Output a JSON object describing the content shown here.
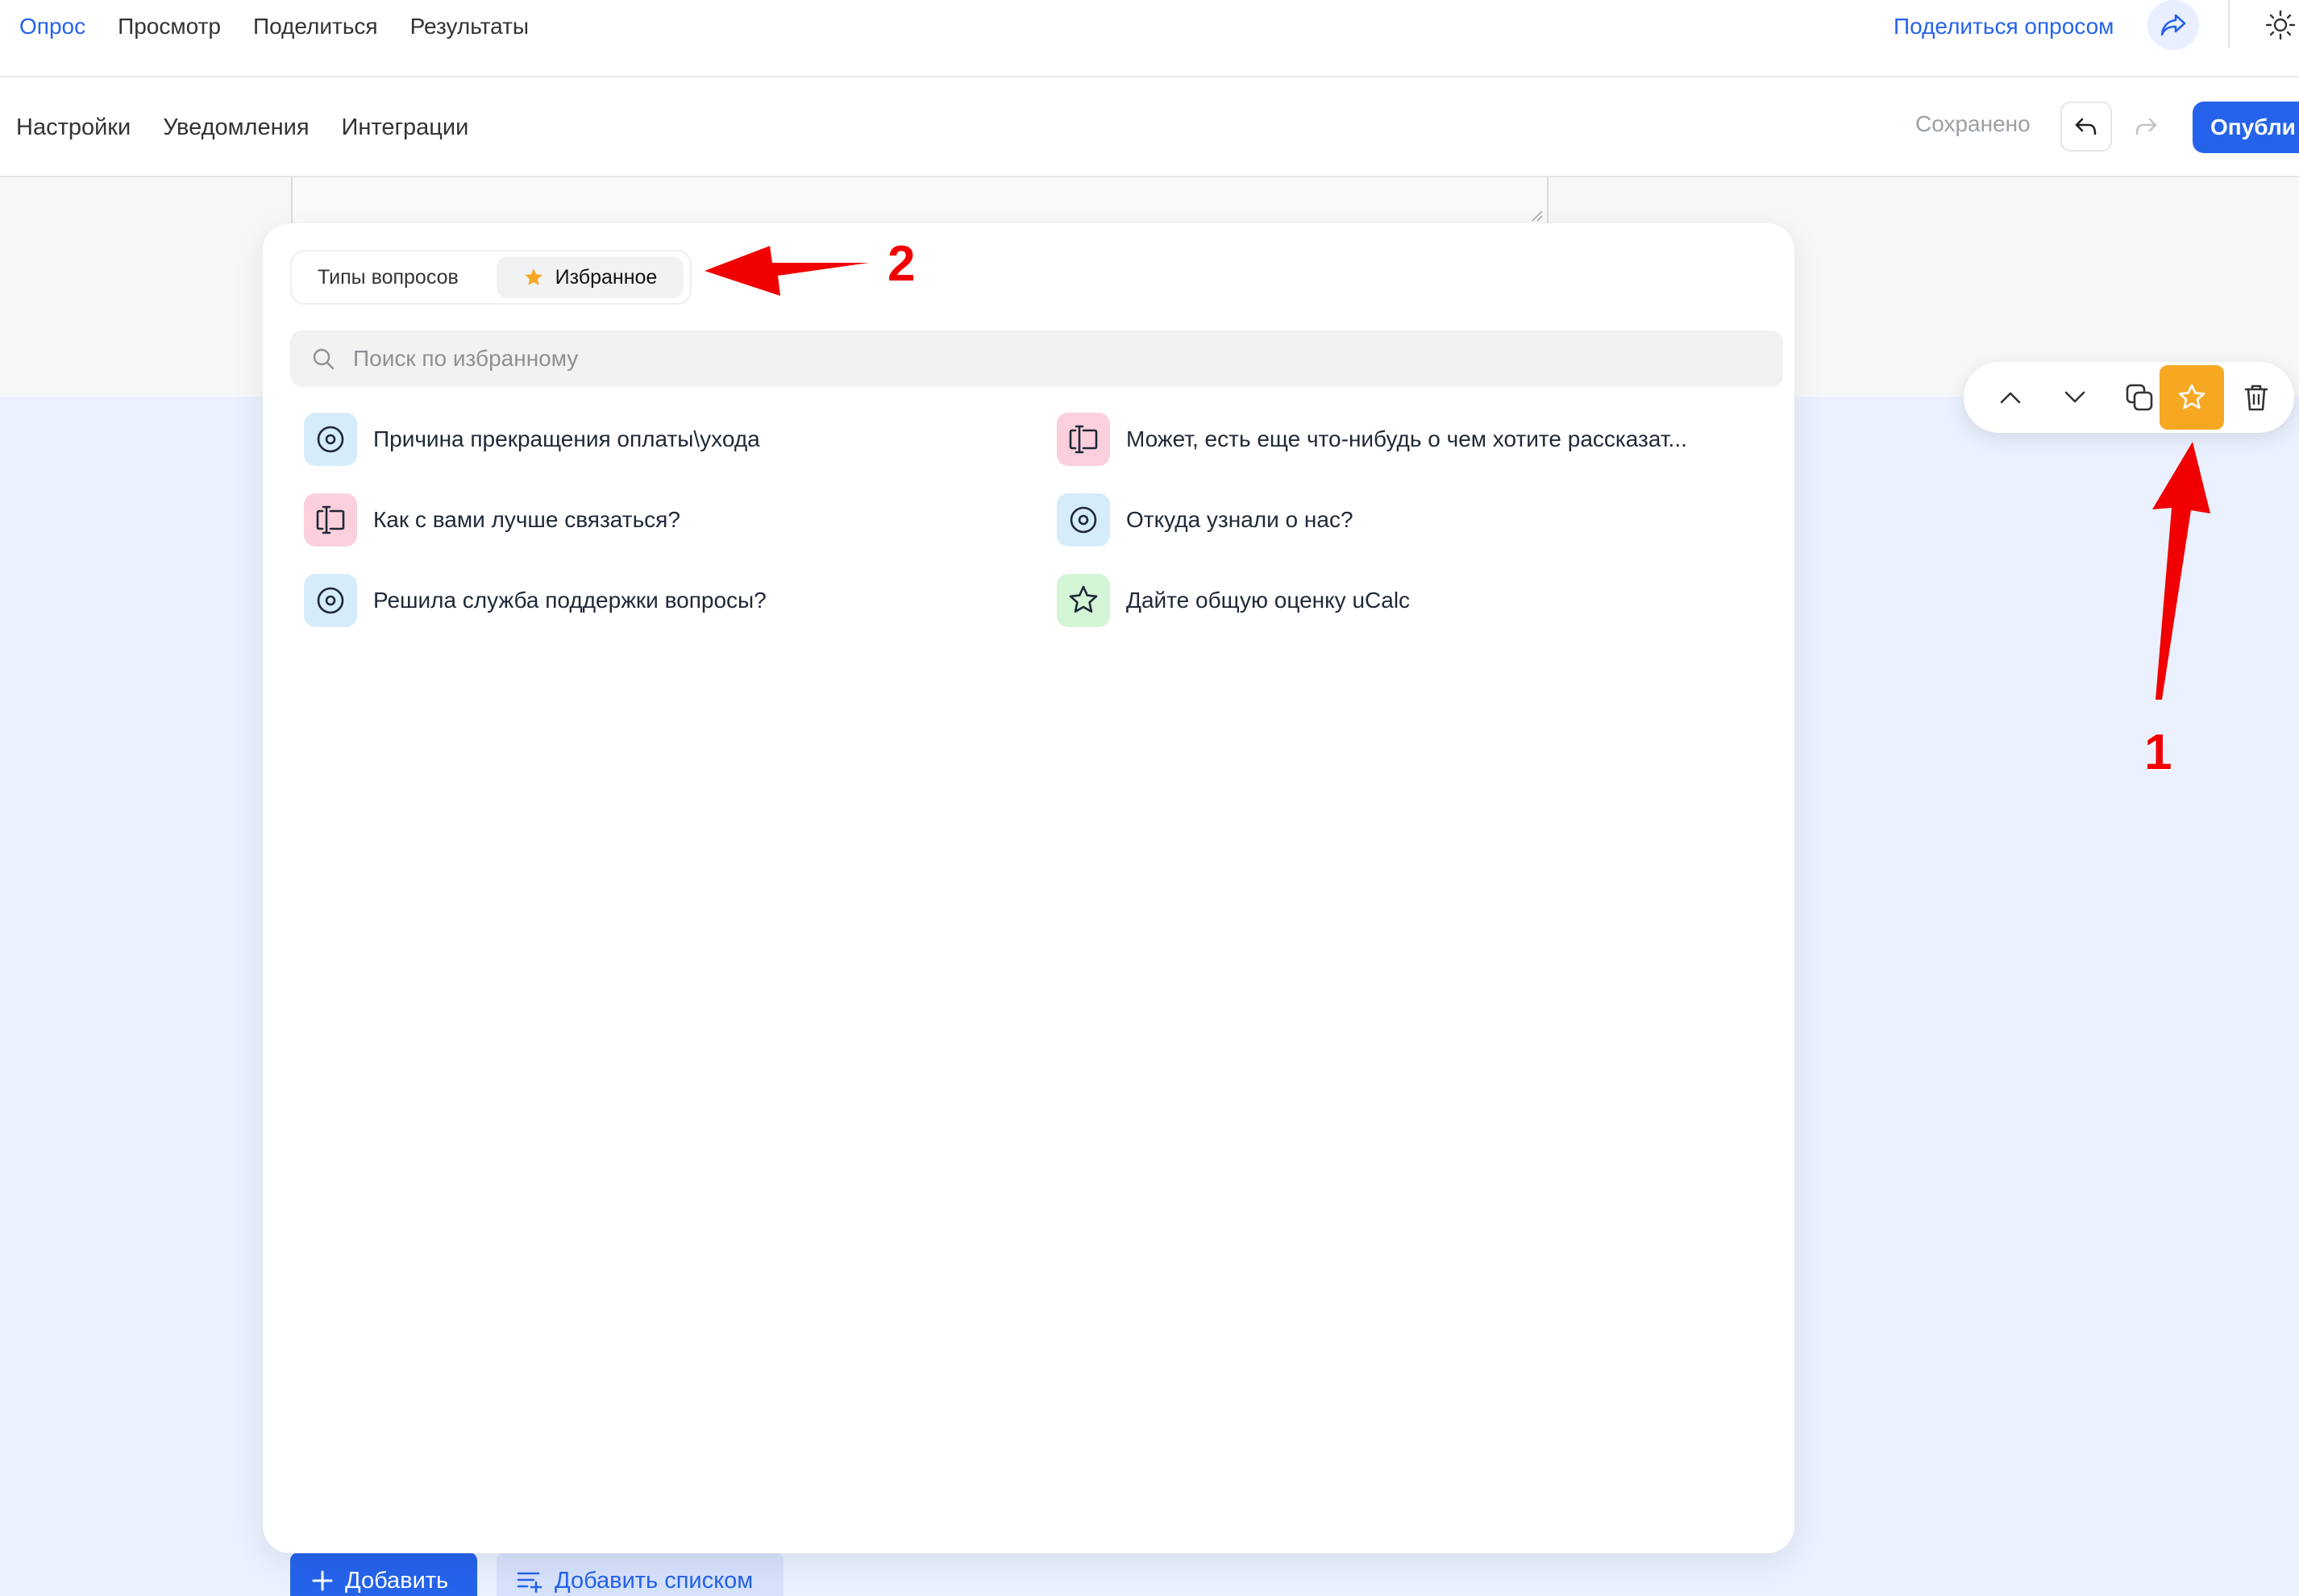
{
  "top_nav": {
    "items": [
      "Опрос",
      "Просмотр",
      "Поделиться",
      "Результаты"
    ],
    "share_link": "Поделиться опросом",
    "share_icon": "share-arrow-icon",
    "theme_icon": "sun-icon"
  },
  "sub_nav": {
    "items": [
      "Настройки",
      "Уведомления",
      "Интеграции"
    ],
    "status": "Сохранено",
    "undo_icon": "undo-icon",
    "redo_icon": "redo-icon",
    "publish": "Опубли"
  },
  "panel": {
    "tabs": {
      "types": "Типы вопросов",
      "favorites": "Избранное"
    },
    "search_placeholder": "Поиск по избранному",
    "items": [
      {
        "label": "Причина прекращения оплаты\\ухода",
        "icon": "radio-icon",
        "color": "#d5ecfb"
      },
      {
        "label": "Может, есть еще что-нибудь о чем хотите рассказат...",
        "icon": "text-field-icon",
        "color": "#fbd0dc"
      },
      {
        "label": "Как с вами лучше связаться?",
        "icon": "text-field-icon",
        "color": "#fbd0dc"
      },
      {
        "label": "Откуда узнали о нас?",
        "icon": "radio-icon",
        "color": "#d5ecfb"
      },
      {
        "label": "Решила служба поддержки вопросы?",
        "icon": "radio-icon",
        "color": "#d5ecfb"
      },
      {
        "label": "Дайте общую оценку uCalc",
        "icon": "star-icon",
        "color": "#d4f4d6"
      }
    ]
  },
  "question_toolbar": {
    "buttons": [
      "chevron-up-icon",
      "chevron-down-icon",
      "duplicate-icon",
      "star-icon",
      "trash-icon"
    ],
    "active_color": "#f7a823"
  },
  "bottom": {
    "add": "Добавить",
    "add_list": "Добавить списком"
  },
  "annotations": {
    "label_1": "1",
    "label_2": "2"
  },
  "colors": {
    "accent": "#2563eb",
    "favorite": "#f7a823",
    "arrow": "#f00000"
  }
}
